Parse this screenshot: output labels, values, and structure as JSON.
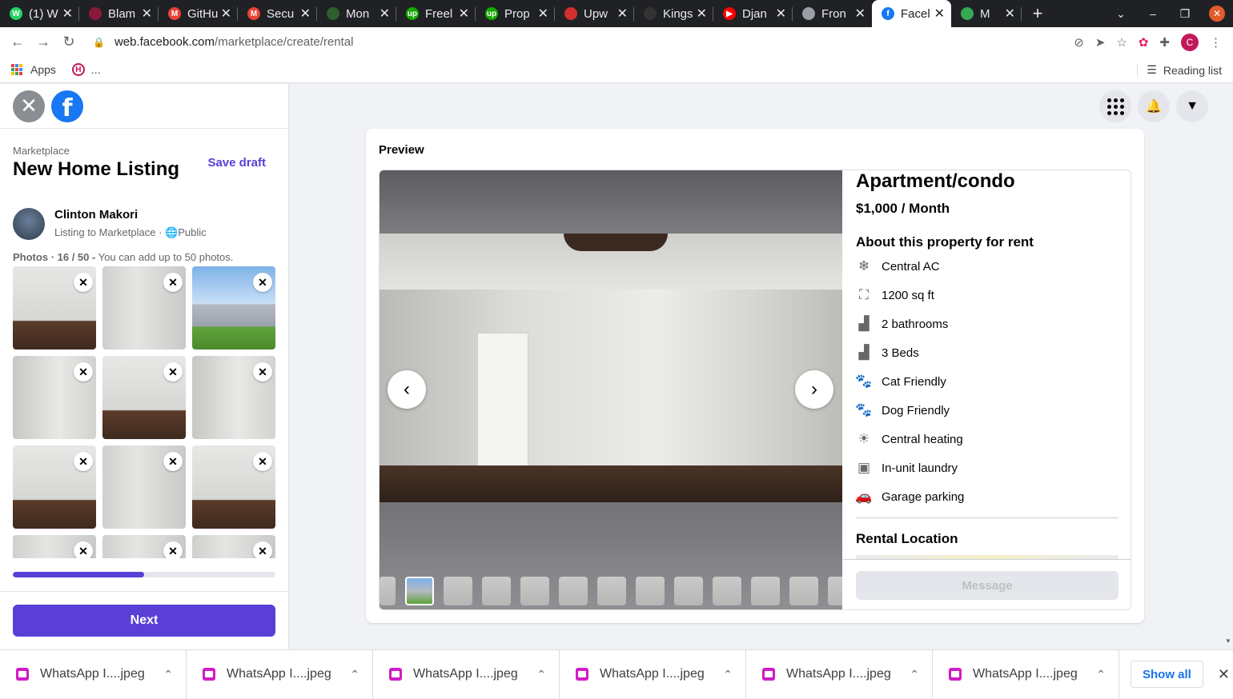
{
  "browser": {
    "tabs": [
      {
        "title": "(1) W",
        "color": "#25d366",
        "glyph": "W"
      },
      {
        "title": "Blam",
        "color": "#8b1a3a",
        "glyph": ""
      },
      {
        "title": "GitHu",
        "color": "#ea4335",
        "glyph": "M"
      },
      {
        "title": "Secu",
        "color": "#ea4335",
        "glyph": "M"
      },
      {
        "title": "Mon",
        "color": "#2e5d2e",
        "glyph": ""
      },
      {
        "title": "Freel",
        "color": "#14a800",
        "glyph": "up"
      },
      {
        "title": "Prop",
        "color": "#14a800",
        "glyph": "up"
      },
      {
        "title": "Upw",
        "color": "#d32f2f",
        "glyph": ""
      },
      {
        "title": "Kings",
        "color": "#333333",
        "glyph": ""
      },
      {
        "title": "Djan",
        "color": "#ff0000",
        "glyph": "▶"
      },
      {
        "title": "Fron",
        "color": "#9aa0a6",
        "glyph": ""
      },
      {
        "title": "Facel",
        "color": "#1877f2",
        "glyph": "f"
      },
      {
        "title": "M",
        "color": "#34a853",
        "glyph": ""
      }
    ],
    "url_host": "web.facebook.com",
    "url_path": "/marketplace/create/rental",
    "bookmarks_apps": "Apps",
    "bookmarks_more": "...",
    "reading_list": "Reading list",
    "profile_initial": "C"
  },
  "left": {
    "crumb": "Marketplace",
    "title": "New Home Listing",
    "save_draft": "Save draft",
    "seller_name": "Clinton Makori",
    "seller_sub": "Listing to Marketplace ·",
    "seller_visibility": "Public",
    "photos_label": "Photos",
    "photos_count": "· 16 / 50 -",
    "photos_hint": "You can add up to 50 photos.",
    "progress_fraction": 0.5,
    "next": "Next"
  },
  "preview": {
    "label": "Preview",
    "title": "Apartment/condo",
    "price": "$1,000 / Month",
    "about": "About this property for rent",
    "features": [
      {
        "icon": "snowflake-icon",
        "glyph": "❄",
        "text": "Central AC"
      },
      {
        "icon": "area-icon",
        "glyph": "⛶",
        "text": "1200 sq ft"
      },
      {
        "icon": "bathroom-icon",
        "glyph": "▟",
        "text": "2 bathrooms"
      },
      {
        "icon": "bed-icon",
        "glyph": "▟",
        "text": "3 Beds"
      },
      {
        "icon": "paw-icon",
        "glyph": "🐾",
        "text": "Cat Friendly"
      },
      {
        "icon": "paw-icon",
        "glyph": "🐾",
        "text": "Dog Friendly"
      },
      {
        "icon": "heating-icon",
        "glyph": "☀",
        "text": "Central heating"
      },
      {
        "icon": "laundry-icon",
        "glyph": "▣",
        "text": "In-unit laundry"
      },
      {
        "icon": "car-icon",
        "glyph": "🚗",
        "text": "Garage parking"
      }
    ],
    "location": "Rental Location",
    "message": "Message"
  },
  "downloads": {
    "items": [
      "WhatsApp I....jpeg",
      "WhatsApp I....jpeg",
      "WhatsApp I....jpeg",
      "WhatsApp I....jpeg",
      "WhatsApp I....jpeg",
      "WhatsApp I....jpeg"
    ],
    "show_all": "Show all"
  }
}
